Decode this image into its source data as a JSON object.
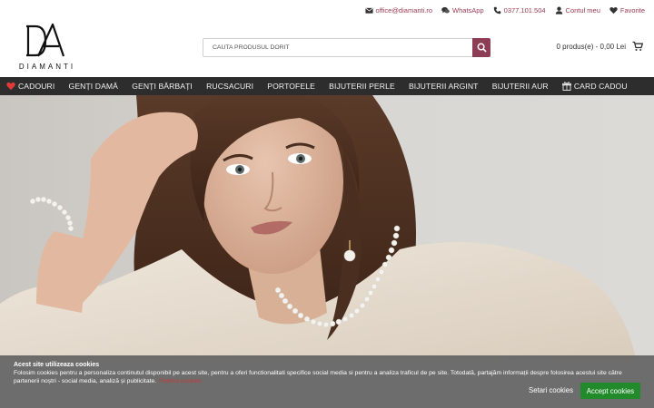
{
  "topbar": {
    "email": "office@diamanti.ro",
    "whatsapp": "WhatsApp",
    "phone": "0377.101.504",
    "account": "Contul meu",
    "favorites": "Favorite"
  },
  "logo": {
    "monogram": "DA",
    "brand": "DIAMANTI"
  },
  "search": {
    "placeholder": "CAUTA PRODUSUL DORIT"
  },
  "cart": {
    "summary": "0 produs(e) - 0,00 Lei"
  },
  "nav": {
    "items": [
      {
        "label": "CADOURI",
        "icon": "heart-icon"
      },
      {
        "label": "GENȚI DAMĂ"
      },
      {
        "label": "GENȚI BĂRBAȚI"
      },
      {
        "label": "RUCSACURI"
      },
      {
        "label": "PORTOFELE"
      },
      {
        "label": "BIJUTERII PERLE"
      },
      {
        "label": "BIJUTERII ARGINT"
      },
      {
        "label": "BIJUTERII AUR"
      },
      {
        "label": "CARD CADOU",
        "icon": "gift-icon"
      }
    ]
  },
  "hero": {
    "image": "woman-with-pearl-jewelry"
  },
  "cookie": {
    "title": "Acest site utilizeaza cookies",
    "text": "Folosim cookies pentru a personaliza continutul disponibil pe acest site, pentru a oferi functionalitati specifice social media si pentru a analiza traficul de pe site. Totodată, partajăm informații despre folosirea acestui site către partenerii noștri - social media, analiză și publicitate.",
    "link": "Politica cookies",
    "settings_label": "Setari cookies",
    "accept_label": "Accept cookies"
  },
  "colors": {
    "brand": "#8d3e55",
    "nav_bg": "#2d2d2d",
    "accept": "#218a2a",
    "heart": "#e03a3a"
  }
}
